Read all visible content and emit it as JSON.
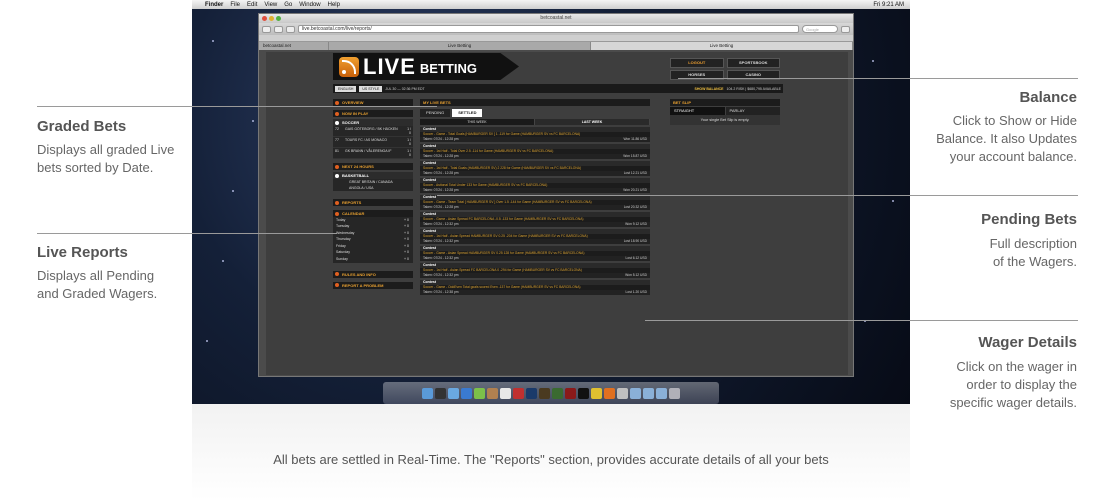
{
  "mac_menubar": {
    "apple": "",
    "items": [
      "Finder",
      "File",
      "Edit",
      "View",
      "Go",
      "Window",
      "Help"
    ],
    "clock": "Fri 9:21 AM"
  },
  "browser": {
    "window_title": "betcoastal.net",
    "url": "live.betcoastal.com/live/reports/",
    "search_placeholder": "Google",
    "tabs": [
      "betcoastal.net",
      "Live Betting",
      "Live Betting"
    ]
  },
  "site": {
    "logo_live": "LIVE",
    "logo_betting": "BETTING",
    "top_buttons": [
      "LOGOUT",
      "SPORTSBOOK",
      "HORSES",
      "CASINO"
    ],
    "language": "ENGLISH",
    "odds_style": "US STYLE",
    "datetime": "JUL 30 — 02:36 PM EDT",
    "balance_label": "SHOW BALANCE",
    "balance_text": "104.2 RISK | $680,795 AVAILABLE",
    "left": {
      "overview": "OVERVIEW",
      "now_in_play": "NOW IN PLAY",
      "soccer": "SOCCER",
      "matches": [
        {
          "minute": "72",
          "teams": "GAIS GÖTEBORG / BK HÄCKEN",
          "score": "1 / 0"
        },
        {
          "minute": "77",
          "teams": "TOURS FC / AS MONACO",
          "score": "1 / 0"
        },
        {
          "minute": "81",
          "teams": "GK BRANN / VÅLERENGA IF",
          "score": "1 / 0"
        }
      ],
      "next_24": "NEXT 24 HOURS",
      "basketball": "BASKETBALL",
      "upcoming": [
        "GREAT BRITAIN / CANADA",
        "ANGOLA / USA"
      ],
      "reports": "REPORTS",
      "calendar": "CALENDAR",
      "calendar_rows": [
        {
          "day": "Today",
          "val": "+ 0"
        },
        {
          "day": "Tuesday",
          "val": "+ 0"
        },
        {
          "day": "Wednesday",
          "val": "+ 0"
        },
        {
          "day": "Thursday",
          "val": "+ 0"
        },
        {
          "day": "Friday",
          "val": "+ 0"
        },
        {
          "day": "Saturday",
          "val": "+ 0"
        },
        {
          "day": "Sunday",
          "val": "+ 0"
        }
      ],
      "rules": "RULES AND INFO",
      "report_problem": "REPORT A PROBLEM"
    },
    "mid": {
      "title": "MY LIVE BETS",
      "tab_pending": "PENDING",
      "tab_settled": "SETTLED",
      "this_week": "THIS WEEK",
      "last_week": "LAST WEEK",
      "bets": [
        {
          "contest": "Contest",
          "desc": "Soccer - Game - Total Goals [HAMBURGER SV ] 1 -119 for Game (HAMBURGER SV vs FC BARCELONA)",
          "taken": "Taken: 07/24 - 12:28 pm",
          "result": "Won  11.86 USD"
        },
        {
          "contest": "Contest",
          "desc": "Soccer - 1st Half - Total Over 2.5 -114 for Game (HAMBURGER SV vs FC BARCELONA)",
          "taken": "Taken: 07/24 - 12:28 pm",
          "result": "Won  15.87 USD"
        },
        {
          "contest": "Contest",
          "desc": "Soccer - 1st Half - Total Goals (HAMBURGER SV) 2 228 for Game (HAMBURGER SV vs FC BARCELONA)",
          "taken": "Taken: 07/24 - 12:28 pm",
          "result": "Lost  12.21 USD"
        },
        {
          "contest": "Contest",
          "desc": "Soccer - Asttonal Total Under 133 for Game (HAMBURGER SV vs FC BARCELONA)",
          "taken": "Taken: 07/24 - 12:28 pm",
          "result": "Won  20.21 USD"
        },
        {
          "contest": "Contest",
          "desc": "Soccer - Game - Team Total [ HAMBURGER SV ] Over 1.5 -144 for Game (HAMBURGER SV vs FC BARCELONA)",
          "taken": "Taken: 07/24 - 12:28 pm",
          "result": "Lost  20.32 USD"
        },
        {
          "contest": "Contest",
          "desc": "Soccer - Game - Asian Spread FC BARCELONA -0.5 -133 for Game (HAMBURGER SV vs FC BARCELONA)",
          "taken": "Taken: 07/24 - 12:32 pm",
          "result": "Won  9.12 USD"
        },
        {
          "contest": "Contest",
          "desc": "Soccer - 1st Half - Asian Spread HAMBURGER SV 0.25 -204 for Game (HAMBURGER SV vs FC BARCELONA)",
          "taken": "Taken: 07/24 - 12:32 pm",
          "result": "Lost  18.90 USD"
        },
        {
          "contest": "Contest",
          "desc": "Soccer - Game - Asian Spread HAMBURGER SV 0.25 128 for Game (HAMBURGER SV vs FC BARCELONA)",
          "taken": "Taken: 07/24 - 12:32 pm",
          "result": "Lost  6.12 USD"
        },
        {
          "contest": "Contest",
          "desc": "Soccer - 1st Half - Asian Spread FC BARCELONA 0 -294 for Game (HAMBURGER SV vs FC BARCELONA)",
          "taken": "Taken: 07/24 - 12:32 pm",
          "result": "Won  5.12 USD"
        },
        {
          "contest": "Contest",
          "desc": "Soccer - Game - OddEven Total goals scored Even -137 for Game (HAMBURGER SV vs FC BARCELONA)",
          "taken": "Taken: 07/24 - 12:38 pm",
          "result": "Lost  1.20 USD"
        }
      ]
    },
    "slip": {
      "title": "BET SLIP",
      "straight": "STRAIGHT",
      "parlay": "PARLAY",
      "empty": "Your single Bet Slip is empty."
    }
  },
  "annotations": {
    "graded_title": "Graded Bets",
    "graded_desc_1": "Displays all graded Live",
    "graded_desc_2": "bets sorted by Date.",
    "reports_title": "Live Reports",
    "reports_desc_1": "Displays all Pending",
    "reports_desc_2": "and Graded Wagers.",
    "balance_title": "Balance",
    "balance_desc_1": "Click to Show or Hide",
    "balance_desc_2": "Balance. It also Updates",
    "balance_desc_3": "your account balance.",
    "pending_title": "Pending Bets",
    "pending_desc_1": "Full description",
    "pending_desc_2": "of the Wagers.",
    "wager_title": "Wager Details",
    "wager_desc_1": "Click on the wager in",
    "wager_desc_2": "order to display the",
    "wager_desc_3": "specific wager details."
  },
  "caption": "All bets are settled in Real-Time. The \"Reports\" section, provides accurate details of all your bets",
  "colors": {
    "accent": "#e8a030",
    "site_bg": "#3e3e3e",
    "annotation_text": "#666666"
  }
}
